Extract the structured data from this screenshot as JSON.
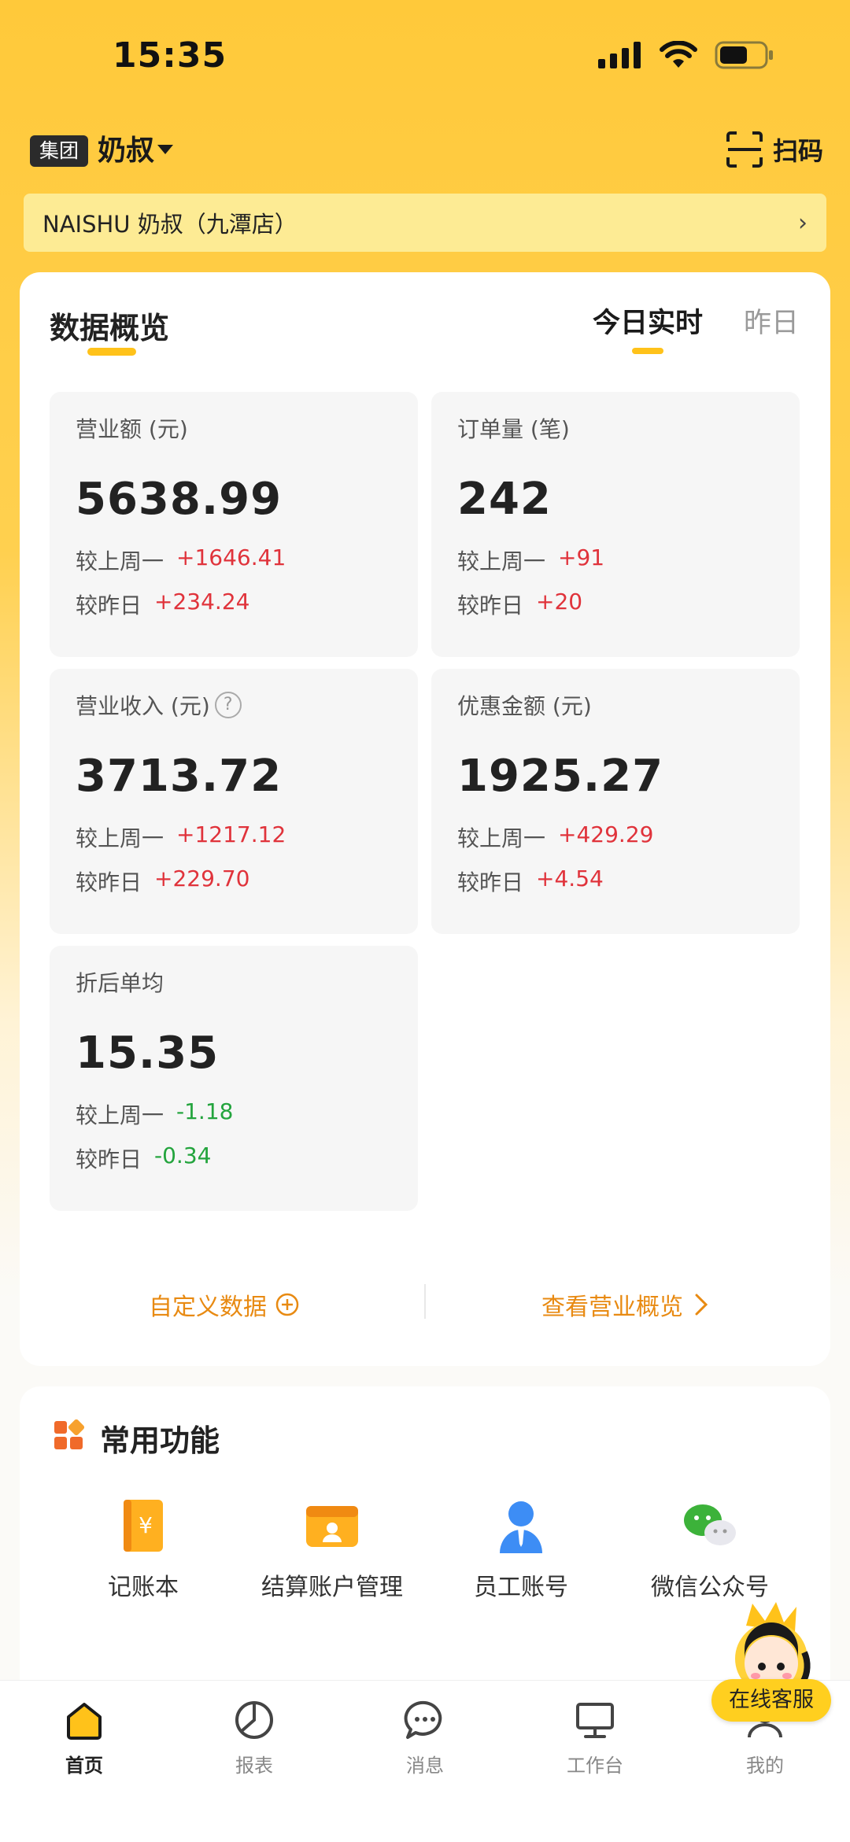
{
  "status_bar": {
    "time": "15:35"
  },
  "header": {
    "group_badge": "集团",
    "org_name": "奶叔",
    "scan_label": "扫码"
  },
  "store": {
    "name": "NAISHU 奶叔（九潭店）"
  },
  "overview": {
    "title": "数据概览",
    "tab_today": "今日实时",
    "tab_yesterday": "昨日",
    "metrics": [
      {
        "label": "营业额 (元)",
        "value": "5638.99",
        "wow_label": "较上周一",
        "wow": "+1646.41",
        "dod_label": "较昨日",
        "dod": "+234.24"
      },
      {
        "label": "订单量 (笔)",
        "value": "242",
        "wow_label": "较上周一",
        "wow": "+91",
        "dod_label": "较昨日",
        "dod": "+20"
      },
      {
        "label": "营业收入 (元)",
        "value": "3713.72",
        "wow_label": "较上周一",
        "wow": "+1217.12",
        "dod_label": "较昨日",
        "dod": "+229.70"
      },
      {
        "label": "优惠金额 (元)",
        "value": "1925.27",
        "wow_label": "较上周一",
        "wow": "+429.29",
        "dod_label": "较昨日",
        "dod": "+4.54"
      },
      {
        "label": "折后单均",
        "value": "15.35",
        "wow_label": "较上周一",
        "wow": "-1.18",
        "dod_label": "较昨日",
        "dod": "-0.34"
      }
    ],
    "custom_data": "自定义数据",
    "view_overview": "查看营业概览"
  },
  "functions": {
    "title": "常用功能",
    "items": [
      {
        "label": "记账本",
        "icon": "ledger-icon"
      },
      {
        "label": "结算账户管理",
        "icon": "wallet-icon"
      },
      {
        "label": "员工账号",
        "icon": "staff-icon"
      },
      {
        "label": "微信公众号",
        "icon": "wechat-icon"
      }
    ]
  },
  "customer_service": {
    "label": "在线客服"
  },
  "tabbar": {
    "items": [
      {
        "label": "首页",
        "icon": "home-icon",
        "active": true
      },
      {
        "label": "报表",
        "icon": "report-icon"
      },
      {
        "label": "消息",
        "icon": "message-icon"
      },
      {
        "label": "工作台",
        "icon": "workbench-icon"
      },
      {
        "label": "我的",
        "icon": "profile-icon"
      }
    ]
  },
  "colors": {
    "brand_yellow": "#ffc21a",
    "accent_orange": "#e88a12",
    "positive_red": "#e0333b",
    "negative_green": "#23a43d"
  }
}
